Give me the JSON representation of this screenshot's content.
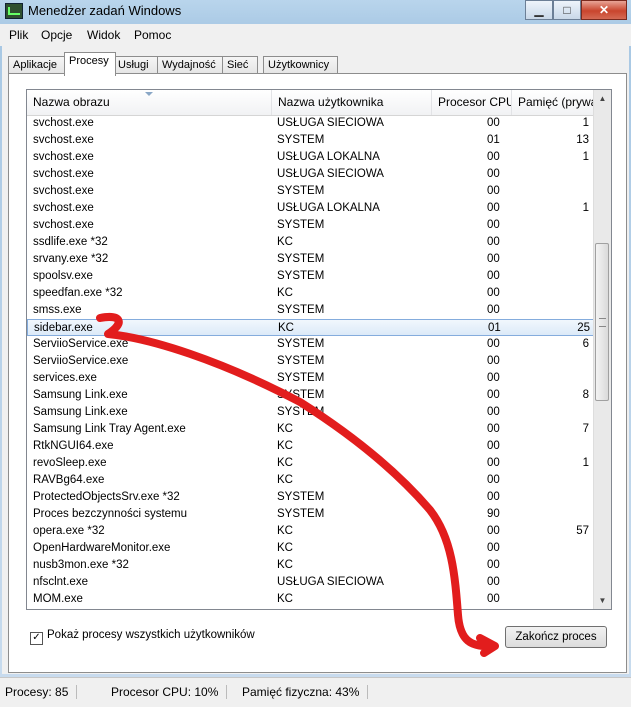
{
  "window": {
    "title": "Menedżer zadań Windows",
    "minimize_icon": "minimize-icon",
    "maximize_icon": "maximize-icon",
    "close_icon": "close-icon"
  },
  "menu": [
    "Plik",
    "Opcje",
    "Widok",
    "Pomoc"
  ],
  "tabs": [
    "Aplikacje",
    "Procesy",
    "Usługi",
    "Wydajność",
    "Sieć",
    "Użytkownicy"
  ],
  "active_tab": "Procesy",
  "columns": [
    "Nazwa obrazu",
    "Nazwa użytkownika",
    "Procesor CPU",
    "Pamięć (prywa"
  ],
  "rows": [
    {
      "name": "svchost.exe",
      "user": "USŁUGA SIECIOWA",
      "cpu": "00",
      "mem": "1"
    },
    {
      "name": "svchost.exe",
      "user": "SYSTEM",
      "cpu": "01",
      "mem": "13"
    },
    {
      "name": "svchost.exe",
      "user": "USŁUGA LOKALNA",
      "cpu": "00",
      "mem": "1"
    },
    {
      "name": "svchost.exe",
      "user": "USŁUGA SIECIOWA",
      "cpu": "00",
      "mem": ""
    },
    {
      "name": "svchost.exe",
      "user": "SYSTEM",
      "cpu": "00",
      "mem": ""
    },
    {
      "name": "svchost.exe",
      "user": "USŁUGA LOKALNA",
      "cpu": "00",
      "mem": "1"
    },
    {
      "name": "svchost.exe",
      "user": "SYSTEM",
      "cpu": "00",
      "mem": ""
    },
    {
      "name": "ssdlife.exe *32",
      "user": "KC",
      "cpu": "00",
      "mem": ""
    },
    {
      "name": "srvany.exe *32",
      "user": "SYSTEM",
      "cpu": "00",
      "mem": ""
    },
    {
      "name": "spoolsv.exe",
      "user": "SYSTEM",
      "cpu": "00",
      "mem": ""
    },
    {
      "name": "speedfan.exe *32",
      "user": "KC",
      "cpu": "00",
      "mem": ""
    },
    {
      "name": "smss.exe",
      "user": "SYSTEM",
      "cpu": "00",
      "mem": ""
    },
    {
      "name": "sidebar.exe",
      "user": "KC",
      "cpu": "01",
      "mem": "25"
    },
    {
      "name": "ServiioService.exe",
      "user": "SYSTEM",
      "cpu": "00",
      "mem": "6"
    },
    {
      "name": "ServiioService.exe",
      "user": "SYSTEM",
      "cpu": "00",
      "mem": ""
    },
    {
      "name": "services.exe",
      "user": "SYSTEM",
      "cpu": "00",
      "mem": ""
    },
    {
      "name": "Samsung Link.exe",
      "user": "SYSTEM",
      "cpu": "00",
      "mem": "8"
    },
    {
      "name": "Samsung Link.exe",
      "user": "SYSTEM",
      "cpu": "00",
      "mem": ""
    },
    {
      "name": "Samsung Link Tray Agent.exe",
      "user": "KC",
      "cpu": "00",
      "mem": "7"
    },
    {
      "name": "RtkNGUI64.exe",
      "user": "KC",
      "cpu": "00",
      "mem": ""
    },
    {
      "name": "revoSleep.exe",
      "user": "KC",
      "cpu": "00",
      "mem": "1"
    },
    {
      "name": "RAVBg64.exe",
      "user": "KC",
      "cpu": "00",
      "mem": ""
    },
    {
      "name": "ProtectedObjectsSrv.exe *32",
      "user": "SYSTEM",
      "cpu": "00",
      "mem": ""
    },
    {
      "name": "Proces bezczynności systemu",
      "user": "SYSTEM",
      "cpu": "90",
      "mem": ""
    },
    {
      "name": "opera.exe *32",
      "user": "KC",
      "cpu": "00",
      "mem": "57"
    },
    {
      "name": "OpenHardwareMonitor.exe",
      "user": "KC",
      "cpu": "00",
      "mem": ""
    },
    {
      "name": "nusb3mon.exe *32",
      "user": "KC",
      "cpu": "00",
      "mem": ""
    },
    {
      "name": "nfsclnt.exe",
      "user": "USŁUGA SIECIOWA",
      "cpu": "00",
      "mem": ""
    },
    {
      "name": "MOM.exe",
      "user": "KC",
      "cpu": "00",
      "mem": ""
    }
  ],
  "selected_row": "sidebar.exe",
  "show_all_users_label": "Pokaż procesy wszystkich użytkowników",
  "show_all_users_checked": true,
  "check_mark": "✓",
  "end_process_label": "Zakończ proces",
  "status": {
    "processes": "Procesy: 85",
    "cpu": "Procesor CPU: 10%",
    "memory": "Pamięć fizyczna: 43%"
  },
  "annotation_color": "#e21d1d"
}
